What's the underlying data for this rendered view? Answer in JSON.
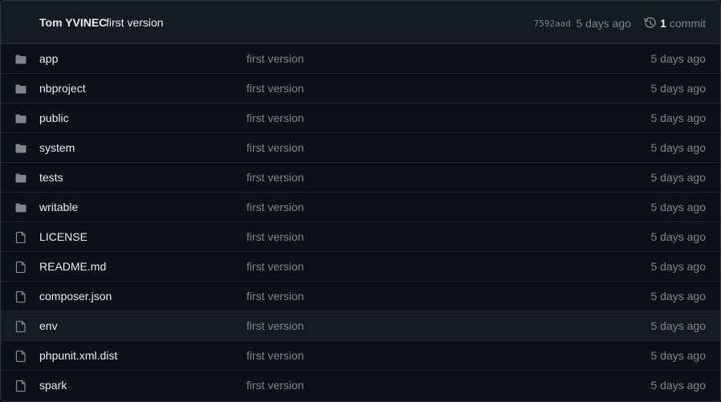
{
  "latest_commit": {
    "author": "Tom YVINEC",
    "message": "first version",
    "sha": "7592aad",
    "age": "5 days ago",
    "commit_count": "1",
    "commit_label": "commit"
  },
  "files": [
    {
      "name": "app",
      "type": "folder",
      "icon": "folder-icon",
      "message": "first version",
      "age": "5 days ago"
    },
    {
      "name": "nbproject",
      "type": "folder",
      "icon": "folder-icon",
      "message": "first version",
      "age": "5 days ago"
    },
    {
      "name": "public",
      "type": "folder",
      "icon": "folder-icon",
      "message": "first version",
      "age": "5 days ago"
    },
    {
      "name": "system",
      "type": "folder",
      "icon": "folder-icon",
      "message": "first version",
      "age": "5 days ago"
    },
    {
      "name": "tests",
      "type": "folder",
      "icon": "folder-icon",
      "message": "first version",
      "age": "5 days ago"
    },
    {
      "name": "writable",
      "type": "folder",
      "icon": "folder-icon",
      "message": "first version",
      "age": "5 days ago"
    },
    {
      "name": "LICENSE",
      "type": "file",
      "icon": "file-icon",
      "message": "first version",
      "age": "5 days ago"
    },
    {
      "name": "README.md",
      "type": "file",
      "icon": "file-icon",
      "message": "first version",
      "age": "5 days ago"
    },
    {
      "name": "composer.json",
      "type": "file",
      "icon": "file-icon",
      "message": "first version",
      "age": "5 days ago"
    },
    {
      "name": "env",
      "type": "file",
      "icon": "file-icon",
      "message": "first version",
      "age": "5 days ago",
      "hovered": true
    },
    {
      "name": "phpunit.xml.dist",
      "type": "file",
      "icon": "file-icon",
      "message": "first version",
      "age": "5 days ago"
    },
    {
      "name": "spark",
      "type": "file",
      "icon": "file-icon",
      "message": "first version",
      "age": "5 days ago"
    }
  ],
  "colors": {
    "background": "#0d1117",
    "header_background": "#161b22",
    "border": "#30363d",
    "text_primary": "#e6edf3",
    "text_muted": "#7d8590"
  }
}
